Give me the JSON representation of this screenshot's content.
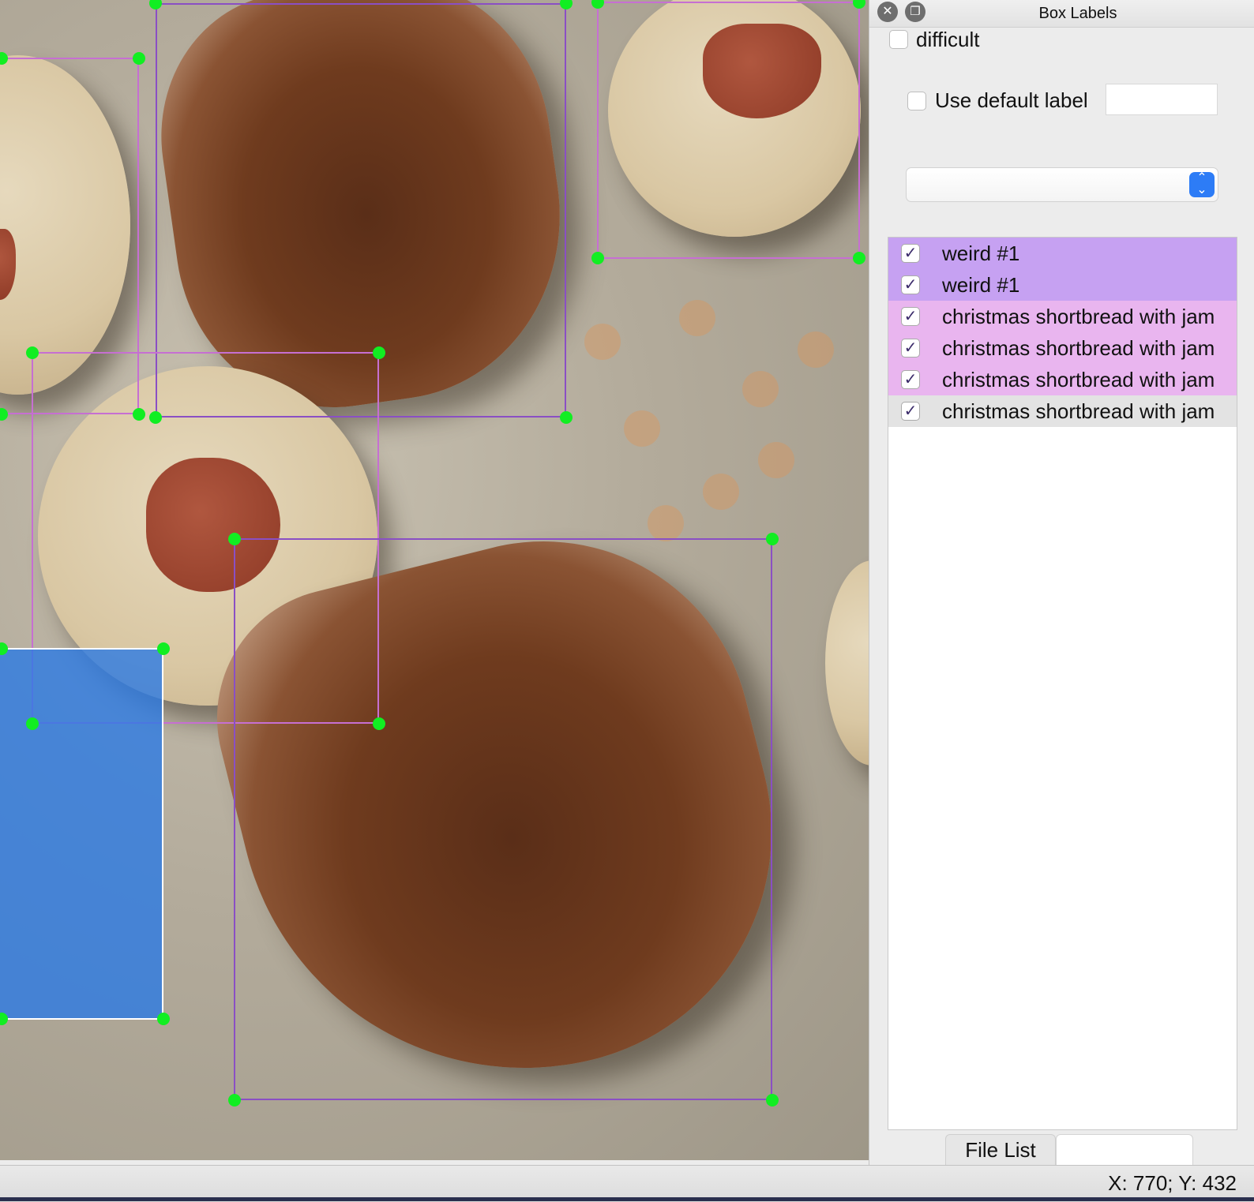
{
  "dock": {
    "title": "Box Labels",
    "close_icon": "close-icon",
    "float_icon": "float-icon",
    "difficult_label": "difficult",
    "difficult_checked": false,
    "use_default_label": "Use default label",
    "use_default_checked": false,
    "default_label_value": "",
    "label_combo_value": ""
  },
  "label_list": [
    {
      "label": "weird #1",
      "checked": true,
      "color": "#c6a1f2"
    },
    {
      "label": "weird #1",
      "checked": true,
      "color": "#c6a1f2"
    },
    {
      "label": "christmas shortbread with jam",
      "checked": true,
      "color": "#e9b5ef"
    },
    {
      "label": "christmas shortbread with jam",
      "checked": true,
      "color": "#e9b5ef"
    },
    {
      "label": "christmas shortbread with jam",
      "checked": true,
      "color": "#e9b5ef"
    },
    {
      "label": "christmas shortbread with jam",
      "checked": true,
      "color": "#e3e3e3"
    }
  ],
  "tabs": {
    "file_list": "File List"
  },
  "status": {
    "coords": "X: 770; Y: 432"
  },
  "colors": {
    "weird_box": "#8a4fc4",
    "shortbread_box": "#c66fd2",
    "handle": "#11ee22",
    "selected_fill": "#2878e6"
  }
}
